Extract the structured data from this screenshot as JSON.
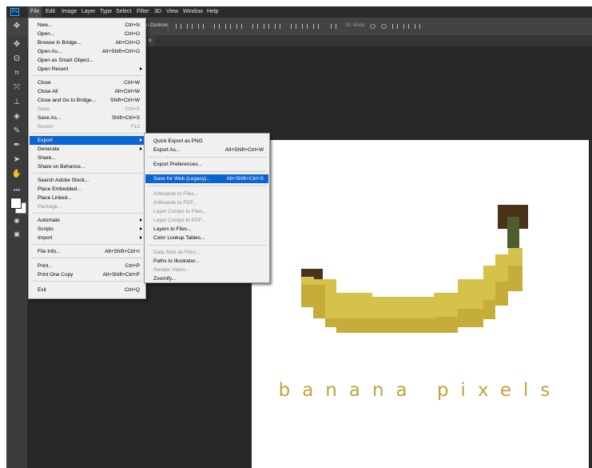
{
  "menubar": {
    "items": [
      "File",
      "Edit",
      "Image",
      "Layer",
      "Type",
      "Select",
      "Filter",
      "3D",
      "View",
      "Window",
      "Help"
    ]
  },
  "options_bar": {
    "form_controls": "form Controls",
    "mode_3d": "3D Mode:"
  },
  "file_menu": {
    "items": [
      {
        "label": "New...",
        "shortcut": "Ctrl+N",
        "enabled": true
      },
      {
        "label": "Open...",
        "shortcut": "Ctrl+O",
        "enabled": true
      },
      {
        "label": "Browse in Bridge...",
        "shortcut": "Alt+Ctrl+O",
        "enabled": true
      },
      {
        "label": "Open As...",
        "shortcut": "Alt+Shift+Ctrl+O",
        "enabled": true
      },
      {
        "label": "Open as Smart Object...",
        "shortcut": "",
        "enabled": true
      },
      {
        "label": "Open Recent",
        "shortcut": "",
        "enabled": true,
        "submenu": true
      },
      {
        "label": "Close",
        "shortcut": "Ctrl+W",
        "enabled": true
      },
      {
        "label": "Close All",
        "shortcut": "Alt+Ctrl+W",
        "enabled": true
      },
      {
        "label": "Close and Go to Bridge...",
        "shortcut": "Shift+Ctrl+W",
        "enabled": true
      },
      {
        "label": "Save",
        "shortcut": "Ctrl+S",
        "enabled": false
      },
      {
        "label": "Save As...",
        "shortcut": "Shift+Ctrl+S",
        "enabled": true
      },
      {
        "label": "Revert",
        "shortcut": "F12",
        "enabled": false
      },
      {
        "label": "Export",
        "shortcut": "",
        "enabled": true,
        "submenu": true,
        "highlighted": true
      },
      {
        "label": "Generate",
        "shortcut": "",
        "enabled": true,
        "submenu": true
      },
      {
        "label": "Share...",
        "shortcut": "",
        "enabled": true
      },
      {
        "label": "Share on Behance...",
        "shortcut": "",
        "enabled": true
      },
      {
        "label": "Search Adobe Stock...",
        "shortcut": "",
        "enabled": true
      },
      {
        "label": "Place Embedded...",
        "shortcut": "",
        "enabled": true
      },
      {
        "label": "Place Linked...",
        "shortcut": "",
        "enabled": true
      },
      {
        "label": "Package...",
        "shortcut": "",
        "enabled": false
      },
      {
        "label": "Automate",
        "shortcut": "",
        "enabled": true,
        "submenu": true
      },
      {
        "label": "Scripts",
        "shortcut": "",
        "enabled": true,
        "submenu": true
      },
      {
        "label": "Import",
        "shortcut": "",
        "enabled": true,
        "submenu": true
      },
      {
        "label": "File Info...",
        "shortcut": "Alt+Shift+Ctrl+I",
        "enabled": true
      },
      {
        "label": "Print...",
        "shortcut": "Ctrl+P",
        "enabled": true
      },
      {
        "label": "Print One Copy",
        "shortcut": "Alt+Shift+Ctrl+P",
        "enabled": true
      },
      {
        "label": "Exit",
        "shortcut": "Ctrl+Q",
        "enabled": true
      }
    ]
  },
  "export_menu": {
    "items": [
      {
        "label": "Quick Export as PNG",
        "shortcut": "",
        "enabled": true
      },
      {
        "label": "Export As...",
        "shortcut": "Alt+Shift+Ctrl+W",
        "enabled": true
      },
      {
        "label": "Export Preferences...",
        "shortcut": "",
        "enabled": true
      },
      {
        "label": "Save for Web (Legacy)...",
        "shortcut": "Alt+Shift+Ctrl+S",
        "enabled": true,
        "highlighted": true
      },
      {
        "label": "Artboards to Files...",
        "shortcut": "",
        "enabled": false
      },
      {
        "label": "Artboards to PDF...",
        "shortcut": "",
        "enabled": false
      },
      {
        "label": "Layer Comps to Files...",
        "shortcut": "",
        "enabled": false
      },
      {
        "label": "Layer Comps to PDF...",
        "shortcut": "",
        "enabled": false
      },
      {
        "label": "Layers to Files...",
        "shortcut": "",
        "enabled": true
      },
      {
        "label": "Color Lookup Tables...",
        "shortcut": "",
        "enabled": true
      },
      {
        "label": "Data Sets as Files...",
        "shortcut": "",
        "enabled": false
      },
      {
        "label": "Paths to Illustrator...",
        "shortcut": "",
        "enabled": true
      },
      {
        "label": "Render Video...",
        "shortcut": "",
        "enabled": false
      },
      {
        "label": "Zoomify...",
        "shortcut": "",
        "enabled": true
      }
    ]
  },
  "document": {
    "brand_text": "banana pixels",
    "colors": {
      "banana_main": "#d5c24b",
      "banana_shade": "#c6ad3a",
      "stem_green": "#4e5d2c",
      "stem_brown": "#4a3318",
      "brand_text": "#c2a33b"
    }
  },
  "tools": [
    "move-tool",
    "marquee-tool",
    "lasso-tool",
    "crop-tool",
    "healing-tool",
    "brush-tool",
    "stamp-tool",
    "eraser-tool",
    "pen-tool",
    "type-tool",
    "path-select-tool",
    "hand-tool",
    "more-tools"
  ]
}
